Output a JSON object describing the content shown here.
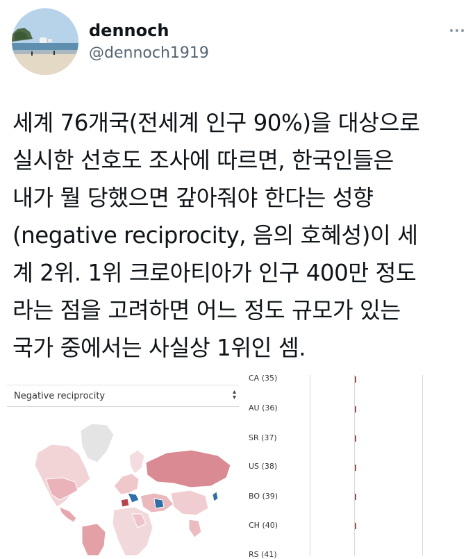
{
  "header": {
    "display_name": "dennoch",
    "handle": "@dennoch1919"
  },
  "tweet": {
    "lines": [
      "세계 76개국(전세계 인구 90%)을 대상으로",
      "실시한 선호도 조사에 따르면, 한국인들은",
      "내가 뭘 당했으면 갚아줘야 한다는 성향",
      "(negative reciprocity, 음의 호혜성)이 세",
      "계 2위. 1위 크로아티아가 인구 400만 정도",
      "라는 점을 고려하면 어느 정도 규모가 있는",
      "국가 중에서는 사실상 1위인 셈."
    ]
  },
  "media": {
    "select_value": "Negative reciprocity",
    "country_labels": [
      "CA (35)",
      "AU (36)",
      "SR (37)",
      "US (38)",
      "BO (39)",
      "CH (40)",
      "RS (41)"
    ],
    "colors": {
      "strong_red": "#b5464f",
      "mid_red": "#d98a92",
      "light_red": "#efc4c8",
      "pale": "#f4dfe1",
      "blue": "#2f6fa8",
      "grey": "#e1e1e1"
    }
  },
  "icons": {
    "more": "more-horizontal-icon",
    "select_arrow": "select-updown-icon"
  }
}
